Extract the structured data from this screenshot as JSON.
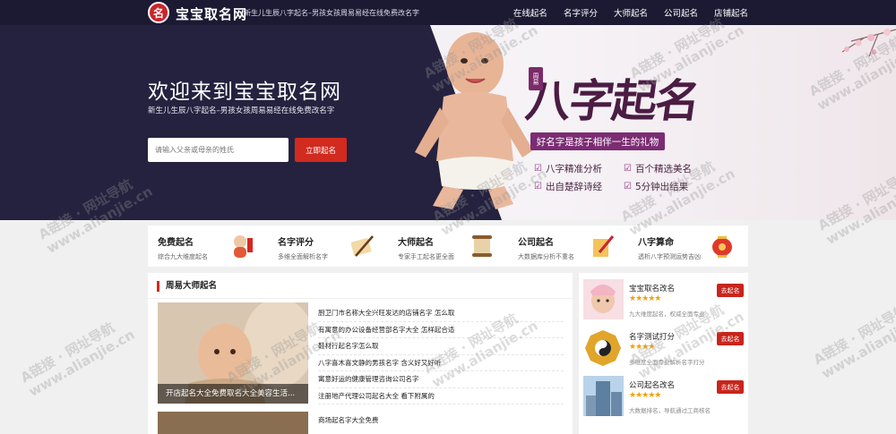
{
  "header": {
    "logo_char": "名",
    "brand": "宝宝取名网",
    "tagline": "新生儿生辰八字起名–男孩女孩周易易经在线免费改名字",
    "nav": [
      "在线起名",
      "名字评分",
      "大师起名",
      "公司起名",
      "店铺起名"
    ]
  },
  "hero": {
    "title": "欢迎来到宝宝取名网",
    "subtitle": "新生儿生辰八字起名–男孩女孩周易易经在线免费改名字",
    "input_placeholder": "请输入父亲或母亲的姓氏",
    "button": "立即起名",
    "banner_title": "八字起名",
    "banner_seal": "周易",
    "banner_slogan": "好名字是孩子相伴一生的礼物",
    "features": [
      "八字精准分析",
      "百个精选美名",
      "出自楚辞诗经",
      "5分钟出结果"
    ]
  },
  "services": [
    {
      "title": "免费起名",
      "desc": "综合九大维度起名",
      "icon": "baby-icon"
    },
    {
      "title": "名字评分",
      "desc": "多维全面解析名字",
      "icon": "scroll-brush-icon"
    },
    {
      "title": "大师起名",
      "desc": "专家手工起名更全面",
      "icon": "scroll-icon"
    },
    {
      "title": "公司起名",
      "desc": "大数据库分析不重名",
      "icon": "pen-paper-icon"
    },
    {
      "title": "八字算命",
      "desc": "透析八字预测运势吉凶",
      "icon": "lantern-icon"
    }
  ],
  "main": {
    "section_title": "周易大师起名",
    "featured_caption": "开店起名大全免费取名大全美容生活...",
    "articles": [
      "厨卫门市名称大全兴旺发达的店铺名字 怎么取",
      "有寓意的办公设备经营部名字大全 怎样起合适",
      "鞋材行起名字怎么取",
      "八字喜木喜文静的男孩名字 含义好又好听",
      "寓意好运的健康管理咨询公司名字",
      "注册地产代理公司起名大全 看下附属的"
    ],
    "article_next": "商场起名字大全免费"
  },
  "sidebar": [
    {
      "title": "宝宝取名改名",
      "stars": "★★★★★",
      "desc": "九大维度起名，权威全面专业",
      "button": "去起名"
    },
    {
      "title": "名字测试打分",
      "stars": "★★★★",
      "desc": "多维度全面专业解析名字打分",
      "button": "去起名"
    },
    {
      "title": "公司起名改名",
      "stars": "★★★★★",
      "desc": "大数据排名，导航通过工商核名",
      "button": "去起名"
    }
  ],
  "watermark": {
    "line1": "A链接 · 网址导航",
    "line2": "www.alianjie.cn"
  },
  "colors": {
    "header_bg": "#1c1a33",
    "hero_dark": "#25223f",
    "accent_red": "#d12a1f",
    "brand_purple": "#7b2c73",
    "star": "#f3a007"
  }
}
